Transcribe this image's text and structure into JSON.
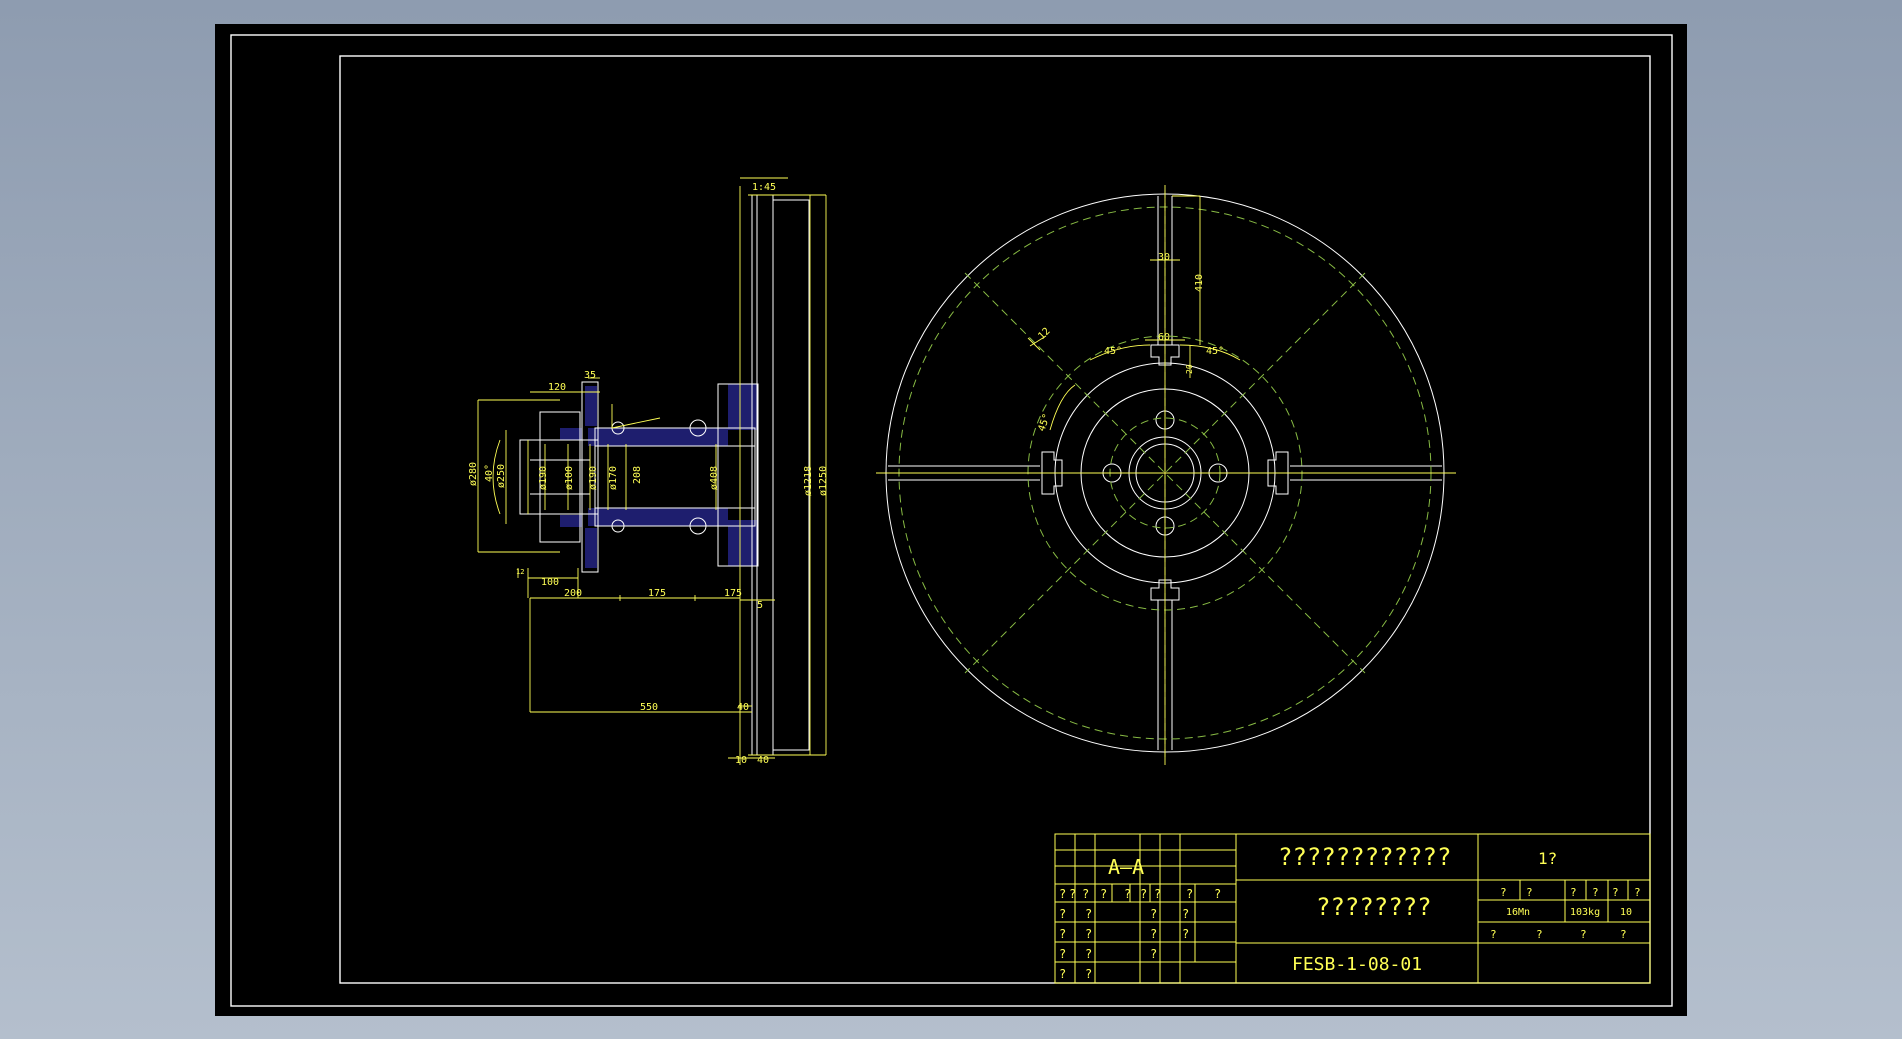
{
  "colors": {
    "background": "#000000",
    "frame": "#ffffff",
    "annotation": "#ffff55",
    "centerline": "#88bb44",
    "fill": "#1e1e6e"
  },
  "side_view": {
    "dims": {
      "d_top": "1:45",
      "d_120": "120",
      "d_35": "35",
      "d_280": "ø280",
      "d_40deg": "40°",
      "d_250": "ø250",
      "d_190": "ø190",
      "d_100a": "ø100",
      "d_190b": "ø190",
      "d_170": "ø170",
      "d_208": "208",
      "d_408": "ø408",
      "d_1218": "ø1218",
      "d_1250": "ø1250",
      "d_12": "12",
      "d_100": "100",
      "d_200": "200",
      "d_175a": "175",
      "d_175b": "175",
      "d_5": "5",
      "d_550": "550",
      "d_40a": "40",
      "d_10": "10",
      "d_40b": "40"
    }
  },
  "front_view": {
    "dims": {
      "d_30": "30",
      "d_410": "410",
      "d_12": "12",
      "d_45a": "45°",
      "d_45b": "45°",
      "d_45c": "45°",
      "d_60": "60",
      "d_20": "20"
    }
  },
  "title_block": {
    "section_label": "A—A",
    "title_main": "????????????",
    "title_sub": "????????",
    "drawing_number": "FESB-1-08-01",
    "sheet_label": "1?",
    "left_header": [
      "?",
      "?",
      "?",
      "?",
      "?",
      "?",
      "?",
      "?",
      "?"
    ],
    "left_rows": [
      [
        "?",
        "?",
        "?",
        "?"
      ],
      [
        "?",
        "?",
        "?",
        "?"
      ],
      [
        "?",
        "?",
        "?"
      ],
      [
        "?",
        "?"
      ]
    ],
    "info_header": [
      "?",
      "?",
      "?",
      "?",
      "?",
      "?"
    ],
    "material": "16Mn",
    "weight": "103kg",
    "scale": "10",
    "info_footer": [
      "?",
      "?",
      "?",
      "?"
    ]
  }
}
